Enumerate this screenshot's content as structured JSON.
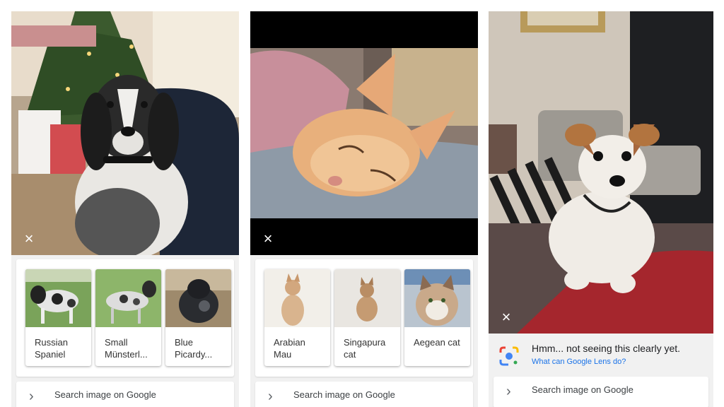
{
  "panels": [
    {
      "close_glyph": "×",
      "results": [
        {
          "label": "Russian\nSpaniel"
        },
        {
          "label": "Small\nMünsterl..."
        },
        {
          "label": "Blue\nPicardy..."
        }
      ],
      "search_label": "Search image on Google"
    },
    {
      "close_glyph": "×",
      "results": [
        {
          "label": "Arabian\nMau"
        },
        {
          "label": "Singapura\ncat"
        },
        {
          "label": "Aegean cat"
        }
      ],
      "search_label": "Search image on Google"
    },
    {
      "close_glyph": "×",
      "lens_title": "Hmm... not seeing this clearly yet.",
      "lens_link": "What can Google Lens do?",
      "search_label": "Search image on Google"
    }
  ],
  "icons": {
    "close": "close-icon",
    "chevron": "chevron-right-icon",
    "lens": "google-lens-icon"
  },
  "colors": {
    "link": "#1a73e8",
    "lens_blue": "#4285f4",
    "lens_red": "#ea4335",
    "lens_yellow": "#fbbc05",
    "lens_green": "#34a853"
  }
}
